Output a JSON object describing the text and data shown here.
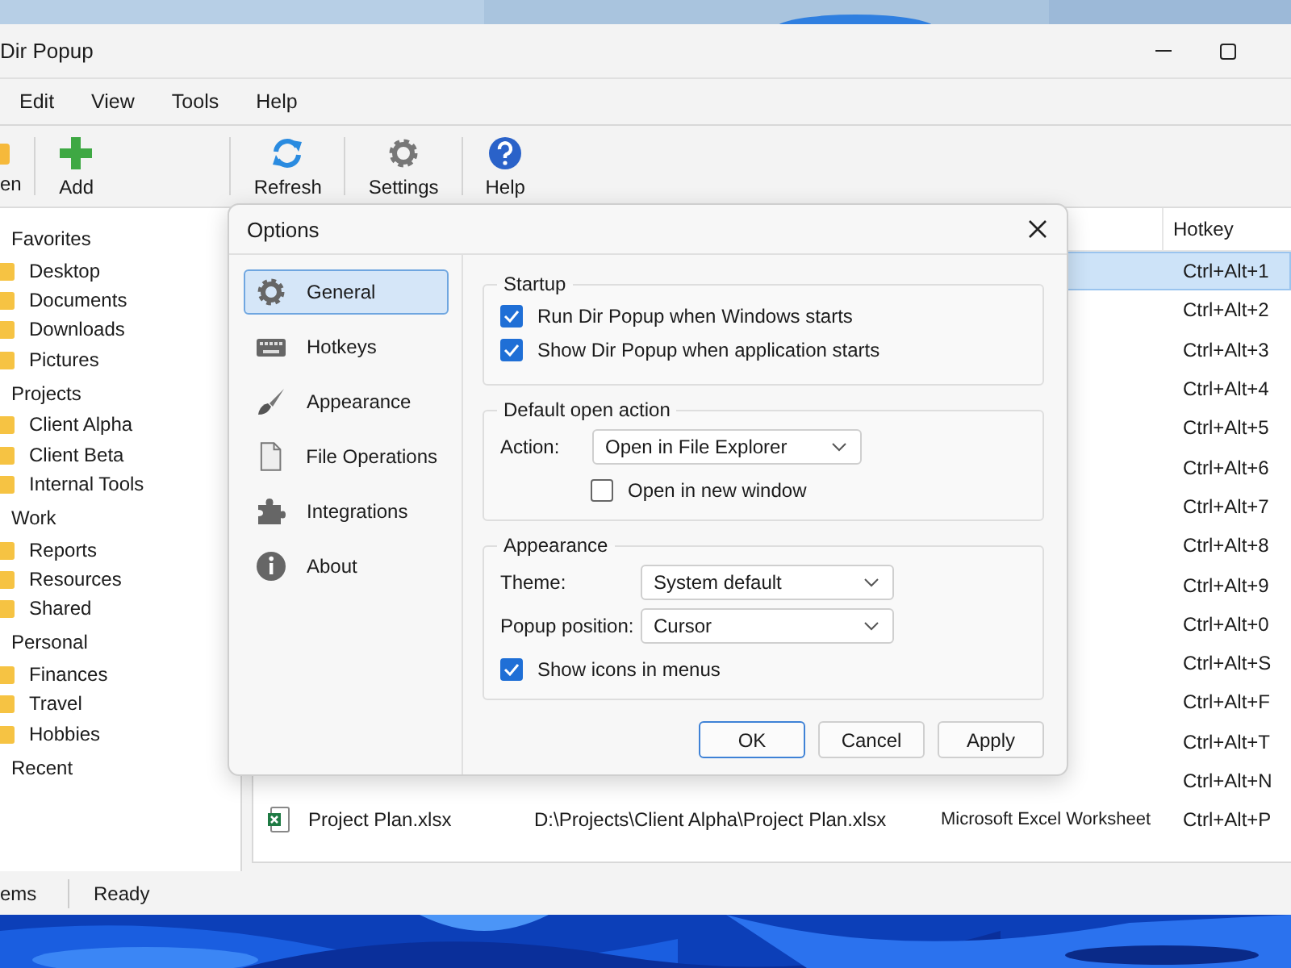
{
  "window": {
    "title": "Dir Popup"
  },
  "menu": [
    {
      "label": "Edit"
    },
    {
      "label": "View"
    },
    {
      "label": "Tools"
    },
    {
      "label": "Help"
    }
  ],
  "toolbar": [
    {
      "label": "en"
    },
    {
      "label": "Add"
    },
    {
      "label": "Refresh"
    },
    {
      "label": "Settings"
    },
    {
      "label": "Help"
    }
  ],
  "sidebar": {
    "items": [
      {
        "label": "Favorites",
        "children": [
          {
            "label": "Desktop"
          },
          {
            "label": "Documents"
          },
          {
            "label": "Downloads"
          },
          {
            "label": "Pictures"
          }
        ]
      },
      {
        "label": "Projects",
        "children": [
          {
            "label": "Client Alpha"
          },
          {
            "label": "Client Beta"
          },
          {
            "label": "Internal Tools"
          }
        ]
      },
      {
        "label": "Work",
        "children": [
          {
            "label": "Reports"
          },
          {
            "label": "Resources"
          },
          {
            "label": "Shared"
          }
        ]
      },
      {
        "label": "Personal",
        "children": [
          {
            "label": "Finances"
          },
          {
            "label": "Travel"
          },
          {
            "label": "Hobbies"
          }
        ]
      },
      {
        "label": "Recent"
      }
    ]
  },
  "table": {
    "columns": [
      "Hotkey"
    ],
    "rows": [
      {
        "hotkey": "Ctrl+Alt+1",
        "selected": true
      },
      {
        "hotkey": "Ctrl+Alt+2",
        "selected": false
      },
      {
        "hotkey": "Ctrl+Alt+3",
        "selected": false
      },
      {
        "hotkey": "Ctrl+Alt+4",
        "selected": false
      },
      {
        "hotkey": "Ctrl+Alt+5",
        "selected": false
      },
      {
        "hotkey": "Ctrl+Alt+6",
        "selected": false
      },
      {
        "hotkey": "Ctrl+Alt+7",
        "selected": false
      },
      {
        "hotkey": "Ctrl+Alt+8",
        "selected": false
      },
      {
        "hotkey": "Ctrl+Alt+9",
        "selected": false
      },
      {
        "hotkey": "Ctrl+Alt+0",
        "selected": false
      },
      {
        "hotkey": "Ctrl+Alt+S",
        "selected": false
      },
      {
        "hotkey": "Ctrl+Alt+F",
        "selected": false
      },
      {
        "hotkey": "Ctrl+Alt+T",
        "selected": false
      },
      {
        "hotkey": "Ctrl+Alt+N",
        "selected": false
      },
      {
        "name": "Project Plan.xlsx",
        "path": "D:\\Projects\\Client Alpha\\Project Plan.xlsx",
        "type": "Microsoft Excel Worksheet",
        "hotkey": "Ctrl+Alt+P",
        "selected": false
      }
    ]
  },
  "status_bar": [
    "ems",
    "Ready"
  ],
  "dialog": {
    "title": "Options",
    "nav": [
      {
        "label": "General",
        "selected": true
      },
      {
        "label": "Hotkeys",
        "selected": false
      },
      {
        "label": "Appearance",
        "selected": false
      },
      {
        "label": "File Operations",
        "selected": false
      },
      {
        "label": "Integrations",
        "selected": false
      },
      {
        "label": "About",
        "selected": false
      }
    ],
    "startup": {
      "title": "Startup",
      "options": [
        {
          "label": "Run Dir Popup when Windows starts",
          "checked": true
        },
        {
          "label": "Show Dir Popup when application starts",
          "checked": true
        }
      ]
    },
    "default_open": {
      "title": "Default open action",
      "fields": [
        {
          "label": "Action:",
          "value": "Open in File Explorer"
        }
      ],
      "options": [
        {
          "label": "Open in new window",
          "checked": false
        }
      ]
    },
    "appearance": {
      "title": "Appearance",
      "fields": [
        {
          "label": "Theme:",
          "value": "System default"
        },
        {
          "label": "Popup position:",
          "value": "Cursor"
        }
      ],
      "options": [
        {
          "label": "Show icons in menus",
          "checked": true
        }
      ]
    },
    "buttons": [
      {
        "label": "OK",
        "default": true
      },
      {
        "label": "Cancel",
        "default": false
      },
      {
        "label": "Apply",
        "default": false
      }
    ]
  }
}
